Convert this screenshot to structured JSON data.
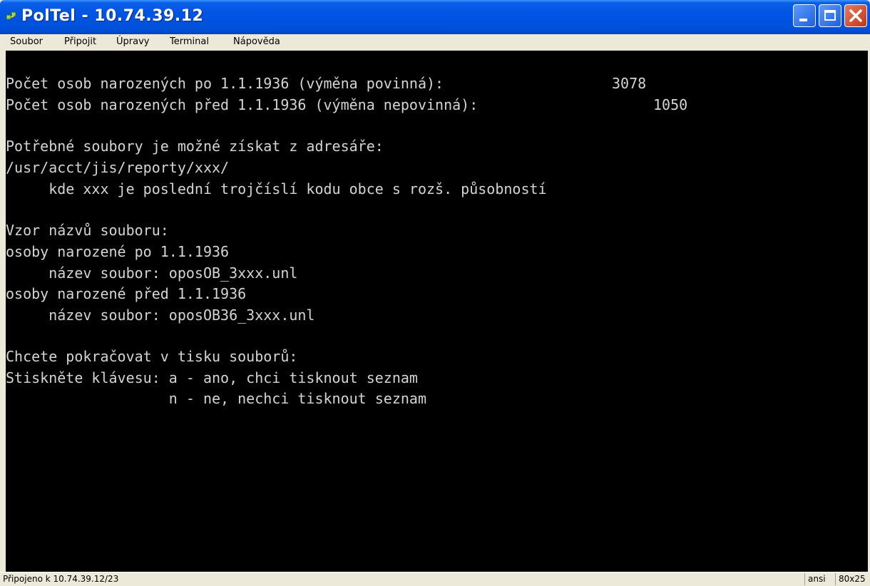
{
  "window": {
    "title": "PolTel - 10.74.39.12"
  },
  "menu": {
    "items": [
      "Soubor",
      "Připojit",
      "Úpravy",
      "Terminal",
      "Nápověda"
    ]
  },
  "terminal": {
    "lines": [
      "Počet osob narozených po 1.1.1936 (výměna povinná):",
      "Počet osob narozených před 1.1.1936 (výměna nepovinná):",
      "Potřebné soubory je možné získat z adresáře:",
      "/usr/acct/jis/reporty/xxx/",
      "     kde xxx je poslední trojčíslí kodu obce s rozš. působností",
      "Vzor názvů souboru:",
      "osoby narozené po 1.1.1936",
      "     název soubor: oposOB_3xxx.unl",
      "osoby narozené před 1.1.1936",
      "     název soubor: oposOB36_3xxx.unl",
      "Chcete pokračovat v tisku souborů:",
      "Stiskněte klávesu: a - ano, chci tisknout seznam",
      "                   n - ne, nechci tisknout seznam"
    ],
    "count_after": "3078",
    "count_before": "1050"
  },
  "status": {
    "connection": "Připojeno k 10.74.39.12/23",
    "emulation": "ansi",
    "size": "80x25"
  },
  "colors": {
    "terminal_bg": "#000000",
    "terminal_fg": "#D4D4D4",
    "titlebar": "#0054E3"
  }
}
